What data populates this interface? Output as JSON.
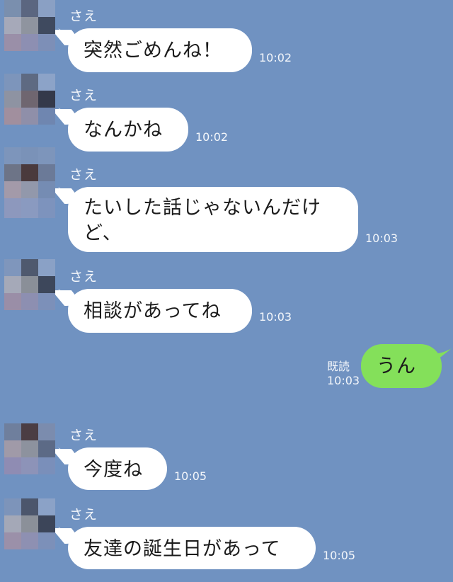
{
  "contact_name": "さえ",
  "read_label": "既読",
  "messages": [
    {
      "text": "突然ごめんね！",
      "time": "10:02"
    },
    {
      "text": "なんかね",
      "time": "10:02"
    },
    {
      "text": "たいした話じゃないんだけ\nど、",
      "time": "10:03"
    },
    {
      "text": "相談があってね",
      "time": "10:03"
    },
    {
      "text": "うん",
      "time": "10:03"
    },
    {
      "text": "今度ね",
      "time": "10:05"
    },
    {
      "text": "友達の誕生日があって",
      "time": "10:05"
    }
  ],
  "colors": {
    "background": "#7092c1",
    "incoming_bubble": "#ffffff",
    "outgoing_bubble": "#84e05a",
    "meta_text": "#f4f7fb"
  }
}
